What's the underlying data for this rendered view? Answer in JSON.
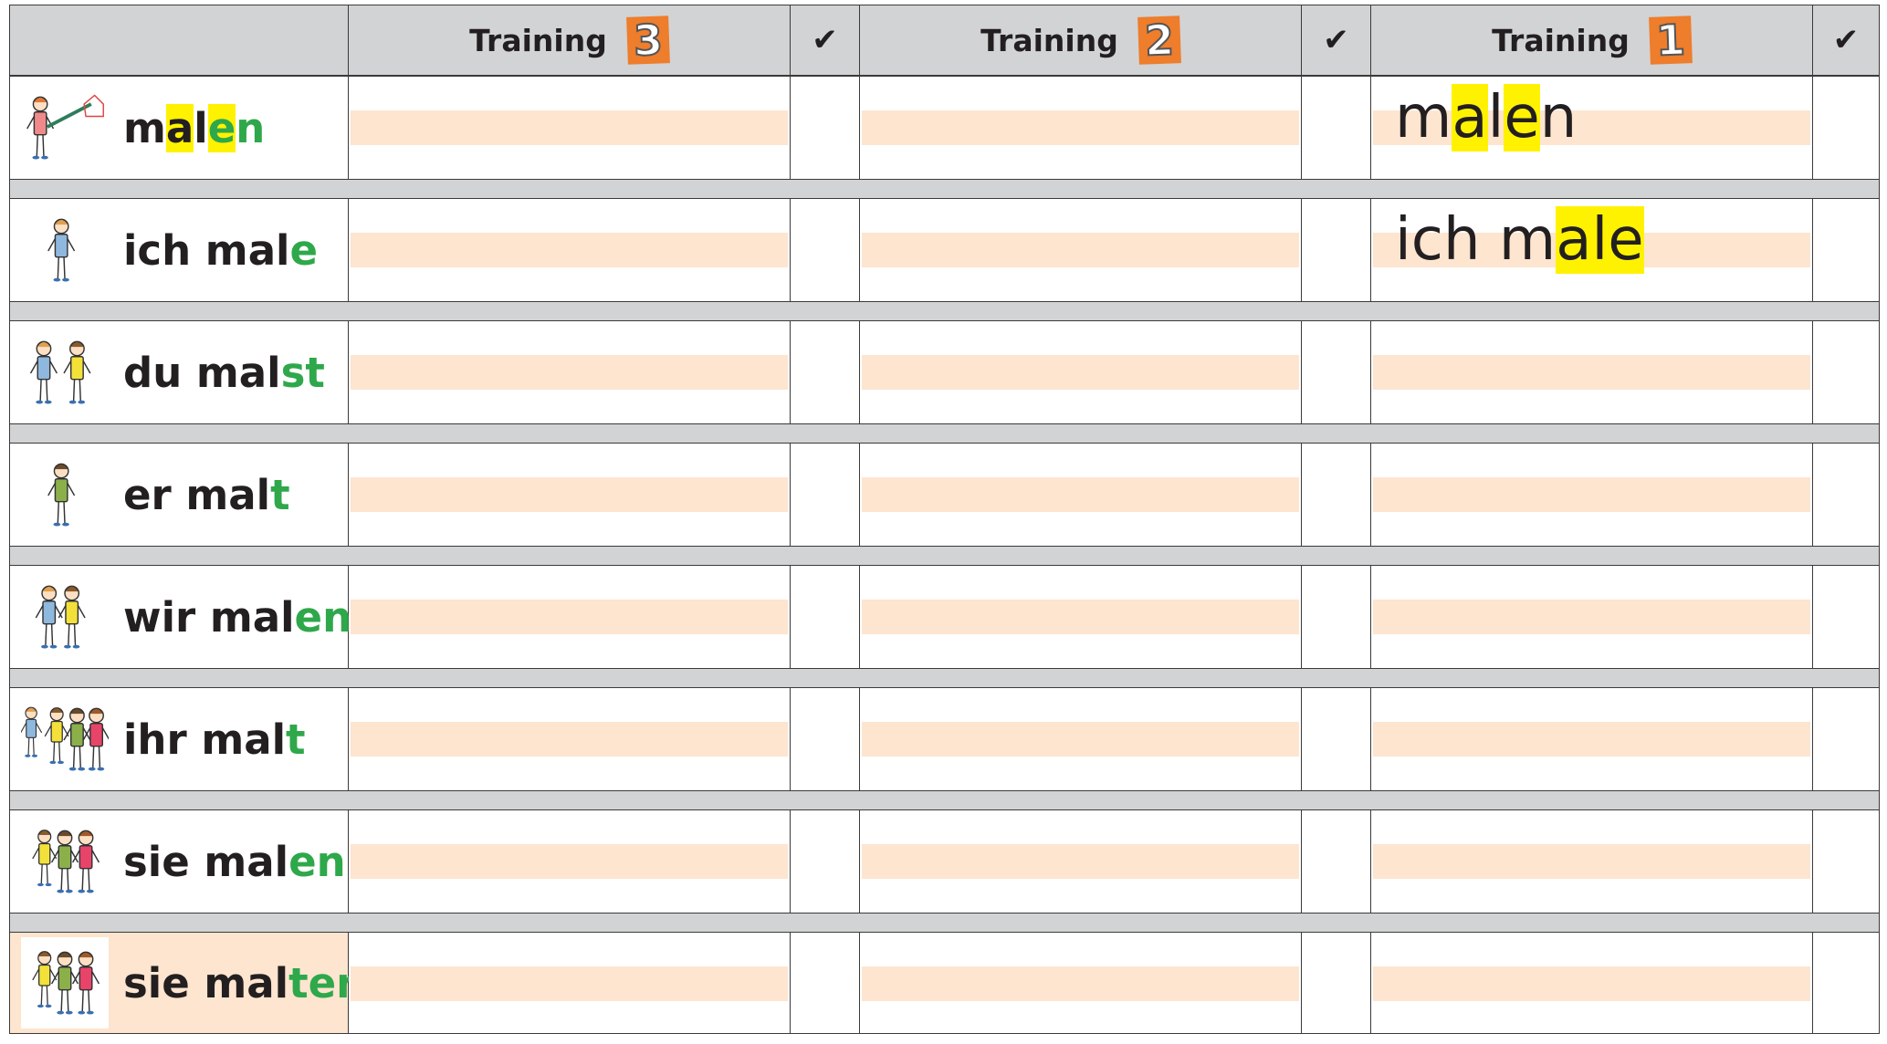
{
  "header": {
    "training_label": "Training",
    "columns": [
      {
        "label": "Training",
        "number": "3"
      },
      {
        "label": "Training",
        "number": "2"
      },
      {
        "label": "Training",
        "number": "1"
      }
    ],
    "check_symbol": "✔"
  },
  "rows": [
    {
      "figure": "child-painting-house-icon",
      "prefix": "m",
      "hl1": "a",
      "mid": "l",
      "hl2": "e",
      "end": "n",
      "ending_color": "#2ea84a",
      "sample": "malen"
    },
    {
      "figure": "girl-icon",
      "stem": "ich mal",
      "ending": "e",
      "sample": "ich male"
    },
    {
      "figure": "two-children-pointing-icon",
      "stem": "du mal",
      "ending": "st"
    },
    {
      "figure": "boy-icon",
      "stem": "er mal",
      "ending": "t"
    },
    {
      "figure": "two-children-icon",
      "stem": "wir mal",
      "ending": "en"
    },
    {
      "figure": "group-of-children-icon",
      "stem": "ihr mal",
      "ending": "t"
    },
    {
      "figure": "family-icon",
      "stem": "sie mal",
      "ending": "en"
    },
    {
      "figure": "family-icon",
      "stem": "sie mal",
      "ending": "ten"
    }
  ],
  "colors": {
    "header_gray": "#d2d3d5",
    "band_peach": "#fde5d0",
    "ending_green": "#2ea84a",
    "highlight_yellow": "#fff200",
    "badge_orange": "#ee7d2c"
  }
}
